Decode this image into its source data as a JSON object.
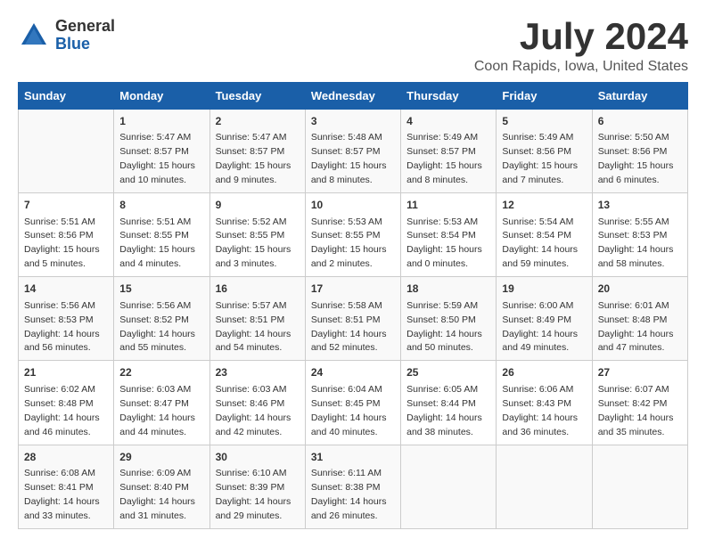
{
  "logo": {
    "general": "General",
    "blue": "Blue"
  },
  "title": "July 2024",
  "subtitle": "Coon Rapids, Iowa, United States",
  "days_of_week": [
    "Sunday",
    "Monday",
    "Tuesday",
    "Wednesday",
    "Thursday",
    "Friday",
    "Saturday"
  ],
  "weeks": [
    [
      {
        "day": "",
        "sunrise": "",
        "sunset": "",
        "daylight": ""
      },
      {
        "day": "1",
        "sunrise": "Sunrise: 5:47 AM",
        "sunset": "Sunset: 8:57 PM",
        "daylight": "Daylight: 15 hours and 10 minutes."
      },
      {
        "day": "2",
        "sunrise": "Sunrise: 5:47 AM",
        "sunset": "Sunset: 8:57 PM",
        "daylight": "Daylight: 15 hours and 9 minutes."
      },
      {
        "day": "3",
        "sunrise": "Sunrise: 5:48 AM",
        "sunset": "Sunset: 8:57 PM",
        "daylight": "Daylight: 15 hours and 8 minutes."
      },
      {
        "day": "4",
        "sunrise": "Sunrise: 5:49 AM",
        "sunset": "Sunset: 8:57 PM",
        "daylight": "Daylight: 15 hours and 8 minutes."
      },
      {
        "day": "5",
        "sunrise": "Sunrise: 5:49 AM",
        "sunset": "Sunset: 8:56 PM",
        "daylight": "Daylight: 15 hours and 7 minutes."
      },
      {
        "day": "6",
        "sunrise": "Sunrise: 5:50 AM",
        "sunset": "Sunset: 8:56 PM",
        "daylight": "Daylight: 15 hours and 6 minutes."
      }
    ],
    [
      {
        "day": "7",
        "sunrise": "Sunrise: 5:51 AM",
        "sunset": "Sunset: 8:56 PM",
        "daylight": "Daylight: 15 hours and 5 minutes."
      },
      {
        "day": "8",
        "sunrise": "Sunrise: 5:51 AM",
        "sunset": "Sunset: 8:55 PM",
        "daylight": "Daylight: 15 hours and 4 minutes."
      },
      {
        "day": "9",
        "sunrise": "Sunrise: 5:52 AM",
        "sunset": "Sunset: 8:55 PM",
        "daylight": "Daylight: 15 hours and 3 minutes."
      },
      {
        "day": "10",
        "sunrise": "Sunrise: 5:53 AM",
        "sunset": "Sunset: 8:55 PM",
        "daylight": "Daylight: 15 hours and 2 minutes."
      },
      {
        "day": "11",
        "sunrise": "Sunrise: 5:53 AM",
        "sunset": "Sunset: 8:54 PM",
        "daylight": "Daylight: 15 hours and 0 minutes."
      },
      {
        "day": "12",
        "sunrise": "Sunrise: 5:54 AM",
        "sunset": "Sunset: 8:54 PM",
        "daylight": "Daylight: 14 hours and 59 minutes."
      },
      {
        "day": "13",
        "sunrise": "Sunrise: 5:55 AM",
        "sunset": "Sunset: 8:53 PM",
        "daylight": "Daylight: 14 hours and 58 minutes."
      }
    ],
    [
      {
        "day": "14",
        "sunrise": "Sunrise: 5:56 AM",
        "sunset": "Sunset: 8:53 PM",
        "daylight": "Daylight: 14 hours and 56 minutes."
      },
      {
        "day": "15",
        "sunrise": "Sunrise: 5:56 AM",
        "sunset": "Sunset: 8:52 PM",
        "daylight": "Daylight: 14 hours and 55 minutes."
      },
      {
        "day": "16",
        "sunrise": "Sunrise: 5:57 AM",
        "sunset": "Sunset: 8:51 PM",
        "daylight": "Daylight: 14 hours and 54 minutes."
      },
      {
        "day": "17",
        "sunrise": "Sunrise: 5:58 AM",
        "sunset": "Sunset: 8:51 PM",
        "daylight": "Daylight: 14 hours and 52 minutes."
      },
      {
        "day": "18",
        "sunrise": "Sunrise: 5:59 AM",
        "sunset": "Sunset: 8:50 PM",
        "daylight": "Daylight: 14 hours and 50 minutes."
      },
      {
        "day": "19",
        "sunrise": "Sunrise: 6:00 AM",
        "sunset": "Sunset: 8:49 PM",
        "daylight": "Daylight: 14 hours and 49 minutes."
      },
      {
        "day": "20",
        "sunrise": "Sunrise: 6:01 AM",
        "sunset": "Sunset: 8:48 PM",
        "daylight": "Daylight: 14 hours and 47 minutes."
      }
    ],
    [
      {
        "day": "21",
        "sunrise": "Sunrise: 6:02 AM",
        "sunset": "Sunset: 8:48 PM",
        "daylight": "Daylight: 14 hours and 46 minutes."
      },
      {
        "day": "22",
        "sunrise": "Sunrise: 6:03 AM",
        "sunset": "Sunset: 8:47 PM",
        "daylight": "Daylight: 14 hours and 44 minutes."
      },
      {
        "day": "23",
        "sunrise": "Sunrise: 6:03 AM",
        "sunset": "Sunset: 8:46 PM",
        "daylight": "Daylight: 14 hours and 42 minutes."
      },
      {
        "day": "24",
        "sunrise": "Sunrise: 6:04 AM",
        "sunset": "Sunset: 8:45 PM",
        "daylight": "Daylight: 14 hours and 40 minutes."
      },
      {
        "day": "25",
        "sunrise": "Sunrise: 6:05 AM",
        "sunset": "Sunset: 8:44 PM",
        "daylight": "Daylight: 14 hours and 38 minutes."
      },
      {
        "day": "26",
        "sunrise": "Sunrise: 6:06 AM",
        "sunset": "Sunset: 8:43 PM",
        "daylight": "Daylight: 14 hours and 36 minutes."
      },
      {
        "day": "27",
        "sunrise": "Sunrise: 6:07 AM",
        "sunset": "Sunset: 8:42 PM",
        "daylight": "Daylight: 14 hours and 35 minutes."
      }
    ],
    [
      {
        "day": "28",
        "sunrise": "Sunrise: 6:08 AM",
        "sunset": "Sunset: 8:41 PM",
        "daylight": "Daylight: 14 hours and 33 minutes."
      },
      {
        "day": "29",
        "sunrise": "Sunrise: 6:09 AM",
        "sunset": "Sunset: 8:40 PM",
        "daylight": "Daylight: 14 hours and 31 minutes."
      },
      {
        "day": "30",
        "sunrise": "Sunrise: 6:10 AM",
        "sunset": "Sunset: 8:39 PM",
        "daylight": "Daylight: 14 hours and 29 minutes."
      },
      {
        "day": "31",
        "sunrise": "Sunrise: 6:11 AM",
        "sunset": "Sunset: 8:38 PM",
        "daylight": "Daylight: 14 hours and 26 minutes."
      },
      {
        "day": "",
        "sunrise": "",
        "sunset": "",
        "daylight": ""
      },
      {
        "day": "",
        "sunrise": "",
        "sunset": "",
        "daylight": ""
      },
      {
        "day": "",
        "sunrise": "",
        "sunset": "",
        "daylight": ""
      }
    ]
  ]
}
